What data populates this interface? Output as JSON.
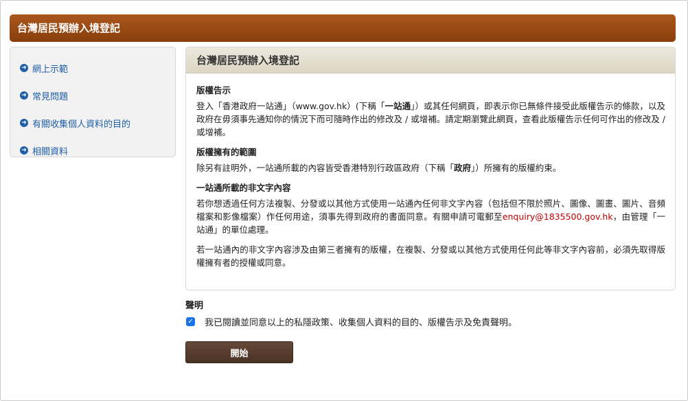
{
  "banner": {
    "title": "台灣居民預辦入境登記"
  },
  "sidebar": {
    "items": [
      {
        "label": "網上示範"
      },
      {
        "label": "常見問題"
      },
      {
        "label": "有關收集個人資料的目的"
      },
      {
        "label": "相關資料"
      }
    ]
  },
  "panel": {
    "title": "台灣居民預辦入境登記",
    "copyright_title": "版權告示",
    "copyright_p1_a": "登入「香港政府一站通」（www.gov.hk）(下稱「",
    "copyright_p1_bold": "一站通",
    "copyright_p1_b": "」）或其任何網頁，即表示你已無條件接受此版權告示的條款，以及政府在毋須事先通知你的情況下而可隨時作出的修改及 / 或增補。請定期瀏覽此網頁，查看此版權告示任何可作出的修改及 / 或增補。",
    "scope_title": "版權擁有的範圍",
    "scope_p_a": "除另有註明外，一站通所載的內容皆受香港特別行政區政府（下稱「",
    "scope_p_bold": "政府",
    "scope_p_b": "」）所擁有的版權約束。",
    "nontext_title": "一站通所載的非文字內容",
    "nontext_p1_a": "若你想透過任何方法複製、分發或以其他方式使用一站通內任何非文字內容（包括但不限於照片、圖像、圖畫、圖片、音頻檔案和影像檔案）作任何用途，須事先得到政府的書面同意。有關申請可電郵至",
    "nontext_email": "enquiry@1835500.gov.hk",
    "nontext_p1_b": "，由管理「一站通」的單位處理。",
    "nontext_p2": "若一站通內的非文字內容涉及由第三者擁有的版權，在複製、分發或以其他方式使用任何此等非文字內容前，必須先取得版權擁有者的授權或同意。"
  },
  "declaration": {
    "title": "聲明",
    "checked": true,
    "text": "我已閱讀並同意以上的私隱政策、收集個人資料的目的、版權告示及免責聲明。"
  },
  "start_button": {
    "label": "開始"
  },
  "colors": {
    "banner": "#97481a",
    "link": "#1f5fa8",
    "email": "#c00000",
    "button": "#56392b",
    "checkbox": "#1a73e8"
  },
  "icons": {
    "sidebar_bullet": "arrow-circle-right-icon",
    "checkbox": "checkmark-icon"
  }
}
